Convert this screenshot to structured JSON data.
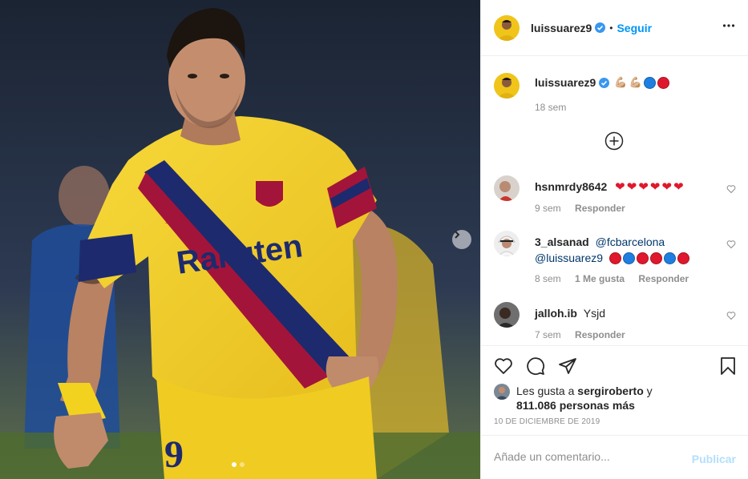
{
  "post": {
    "author": "luissuarez9",
    "follow_label": "Seguir",
    "separator": "•",
    "caption": {
      "username": "luissuarez9",
      "emoji": [
        "💪🏼",
        "💪🏼"
      ],
      "circles": [
        "blue",
        "red"
      ],
      "time": "18 sem"
    },
    "photo": {
      "jersey_text": "Rakuten",
      "number": "9",
      "dots_total": 2,
      "dots_active": 1
    }
  },
  "comments": [
    {
      "username": "hsnmrdy8642",
      "text": "",
      "hearts": 6,
      "time": "9 sem",
      "likes": "",
      "reply_label": "Responder"
    },
    {
      "username": "3_alsanad",
      "mention1": "@fcbarcelona",
      "mention2": "@luissuarez9",
      "circles": [
        "red",
        "blue",
        "red",
        "red",
        "blue",
        "red"
      ],
      "time": "8 sem",
      "likes": "1 Me gusta",
      "reply_label": "Responder"
    },
    {
      "username": "jalloh.ib",
      "text": "Ysjd",
      "time": "7 sem",
      "likes": "",
      "reply_label": "Responder"
    }
  ],
  "likes": {
    "prefix": "Les gusta a",
    "user": "sergiroberto",
    "conjunction": "y",
    "count": "811.086",
    "suffix": "personas más"
  },
  "date": "10 DE DICIEMBRE DE 2019",
  "add_comment": {
    "placeholder": "Añade un comentario...",
    "publish_label": "Publicar"
  },
  "icons": {
    "verified": "verified-badge-icon",
    "more": "more-options-icon",
    "load_more": "plus-circle-icon",
    "like": "heart-icon",
    "comment": "comment-icon",
    "share": "send-icon",
    "save": "bookmark-icon",
    "next": "chevron-right-icon"
  },
  "colors": {
    "accent": "#0095f6",
    "verified": "#3897f0",
    "jersey_yellow": "#f2cf2a",
    "stripe_blue": "#1d2a6e",
    "stripe_red": "#a3143a"
  }
}
